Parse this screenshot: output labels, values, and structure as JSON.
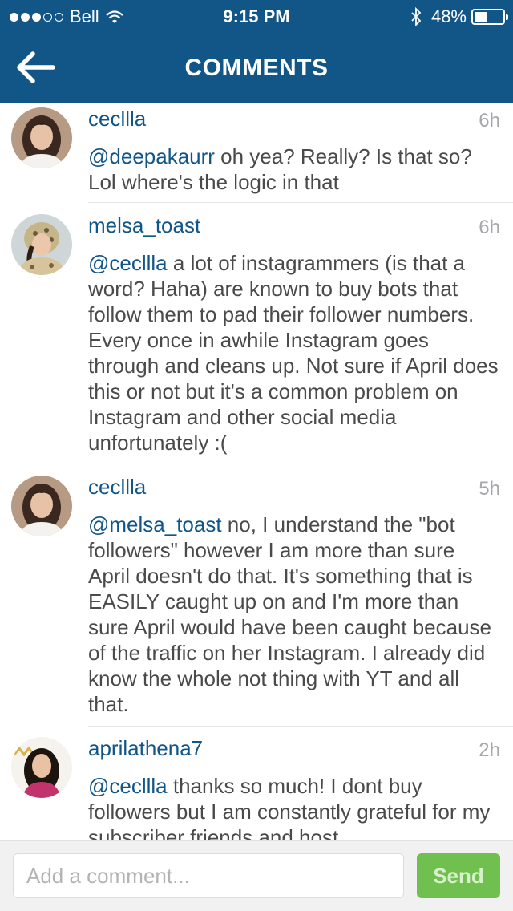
{
  "status": {
    "carrier": "Bell",
    "time": "9:15 PM",
    "battery": "48%",
    "battery_level": 0.48,
    "signal_bars_filled": 3,
    "signal_bars_total": 5
  },
  "nav": {
    "title": "COMMENTS",
    "back_icon": "arrow-left-icon"
  },
  "comments": [
    {
      "username": "cecllla",
      "time": "6h",
      "mention": "@deepakaurr",
      "text": " oh yea? Really? Is that so? Lol where's the logic in that"
    },
    {
      "username": "melsa_toast",
      "time": "6h",
      "mention": "@cecllla",
      "text": " a lot of instagrammers (is that a word? Haha) are known to buy bots that follow them to pad their follower numbers. Every once in awhile Instagram goes through and cleans up. Not sure if April does this or not but it's a common problem on Instagram and other social media unfortunately :("
    },
    {
      "username": "cecllla",
      "time": "5h",
      "mention": "@melsa_toast",
      "text": " no, I understand the \"bot followers\" however I am more than sure April doesn't do that. It's something that is EASILY caught up on and I'm more than sure April would have been caught because of the traffic on her Instagram. I already did know the whole not thing with YT and all that."
    },
    {
      "username": "aprilathena7",
      "time": "2h",
      "mention": "@cecllla",
      "text": " thanks so much!  I dont buy followers  but I am constantly grateful for my subscriber friends and host"
    }
  ],
  "footer": {
    "placeholder": "Add a comment...",
    "send_label": "Send"
  },
  "colors": {
    "brand": "#125688",
    "send": "#70c050",
    "text": "#4a4a4a",
    "muted": "#a5a7aa"
  }
}
